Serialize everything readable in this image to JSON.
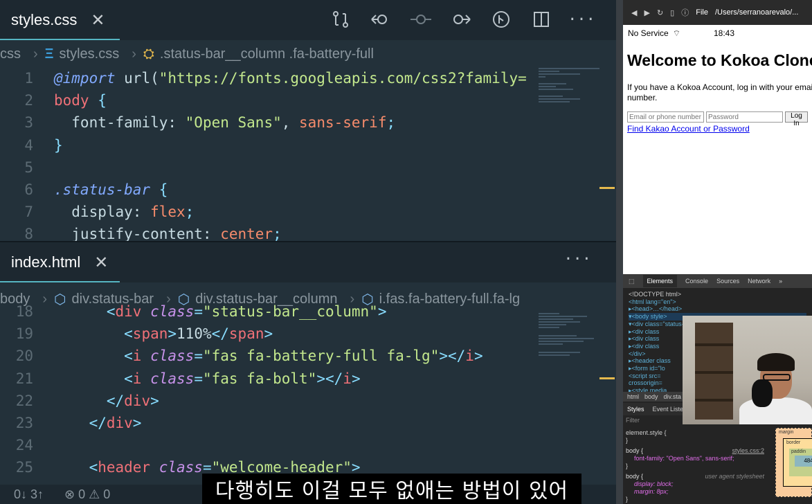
{
  "css_editor": {
    "tab_label": "styles.css",
    "breadcrumb": [
      "css",
      "styles.css",
      ".status-bar__column .fa-battery-full"
    ],
    "lines": [
      {
        "n": "1",
        "parts": [
          [
            "at",
            "@import"
          ],
          [
            "prop",
            " url("
          ],
          [
            "str",
            "\"https://fonts.googleapis.com/css2?family="
          ]
        ]
      },
      {
        "n": "2",
        "parts": [
          [
            "kw",
            "body"
          ],
          [
            "punct",
            " {"
          ]
        ]
      },
      {
        "n": "3",
        "parts": [
          [
            "prop",
            "  font-family: "
          ],
          [
            "str",
            "\"Open Sans\""
          ],
          [
            "prop",
            ", "
          ],
          [
            "val",
            "sans-serif"
          ],
          [
            "punct",
            ";"
          ]
        ]
      },
      {
        "n": "4",
        "parts": [
          [
            "punct",
            "}"
          ]
        ]
      },
      {
        "n": "5",
        "parts": []
      },
      {
        "n": "6",
        "parts": [
          [
            "sel",
            ".status-bar"
          ],
          [
            "punct",
            " {"
          ]
        ]
      },
      {
        "n": "7",
        "parts": [
          [
            "prop",
            "  display: "
          ],
          [
            "val",
            "flex"
          ],
          [
            "punct",
            ";"
          ]
        ]
      },
      {
        "n": "8",
        "parts": [
          [
            "prop",
            "  justify-content: "
          ],
          [
            "val",
            "center"
          ],
          [
            "punct",
            ";"
          ]
        ]
      }
    ]
  },
  "html_editor": {
    "tab_label": "index.html",
    "breadcrumb": [
      "body",
      "div.status-bar",
      "div.status-bar__column",
      "i.fas.fa-battery-full.fa-lg"
    ],
    "lines": [
      {
        "n": "18",
        "parts": [
          [
            "punct",
            "      <"
          ],
          [
            "tag",
            "div"
          ],
          [
            "attr",
            " class"
          ],
          [
            "punct",
            "="
          ],
          [
            "str",
            "\"status-bar__column\""
          ],
          [
            "punct",
            ">"
          ]
        ]
      },
      {
        "n": "19",
        "parts": [
          [
            "punct",
            "        <"
          ],
          [
            "tag",
            "span"
          ],
          [
            "punct",
            ">"
          ],
          [
            "prop",
            "110%"
          ],
          [
            "punct",
            "</"
          ],
          [
            "tag",
            "span"
          ],
          [
            "punct",
            ">"
          ]
        ]
      },
      {
        "n": "20",
        "parts": [
          [
            "punct",
            "        <"
          ],
          [
            "tag",
            "i"
          ],
          [
            "attr",
            " class"
          ],
          [
            "punct",
            "="
          ],
          [
            "str",
            "\"fas fa-battery-full fa-lg\""
          ],
          [
            "punct",
            "></"
          ],
          [
            "tag",
            "i"
          ],
          [
            "punct",
            ">"
          ]
        ]
      },
      {
        "n": "21",
        "parts": [
          [
            "punct",
            "        <"
          ],
          [
            "tag",
            "i"
          ],
          [
            "attr",
            " class"
          ],
          [
            "punct",
            "="
          ],
          [
            "str",
            "\"fas fa-bolt\""
          ],
          [
            "punct",
            "></"
          ],
          [
            "tag",
            "i"
          ],
          [
            "punct",
            ">"
          ]
        ]
      },
      {
        "n": "22",
        "parts": [
          [
            "punct",
            "      </"
          ],
          [
            "tag",
            "div"
          ],
          [
            "punct",
            ">"
          ]
        ]
      },
      {
        "n": "23",
        "parts": [
          [
            "punct",
            "    </"
          ],
          [
            "tag",
            "div"
          ],
          [
            "punct",
            ">"
          ]
        ]
      },
      {
        "n": "24",
        "parts": []
      },
      {
        "n": "25",
        "parts": [
          [
            "punct",
            "    <"
          ],
          [
            "tag",
            "header"
          ],
          [
            "attr",
            " class"
          ],
          [
            "punct",
            "="
          ],
          [
            "str",
            "\"welcome-header\""
          ],
          [
            "punct",
            ">"
          ]
        ]
      }
    ]
  },
  "statusbar": {
    "sync": "0↓ 3↑",
    "problems": "⊗ 0 ⚠ 0"
  },
  "browser": {
    "file_label": "File",
    "url": "/Users/serranoarevalo/...",
    "carrier": "No Service",
    "time": "18:43",
    "heading": "Welcome to Kokoa Clone",
    "intro_1": "If you have a Kokoa Account, log in with your email or phone",
    "intro_2": "number.",
    "email_placeholder": "Email or phone number",
    "password_placeholder": "Password",
    "login_button": "Log In",
    "link": "Find Kakao Account or Password"
  },
  "devtools": {
    "tabs": [
      "Elements",
      "Console",
      "Sources",
      "Network"
    ],
    "dom": [
      "<!DOCTYPE html>",
      "<html lang=\"en\">",
      "▸<head>…</head>",
      "▾<body style>",
      "  ▾<div class=\"status-bar\">",
      "    ▸<div class",
      "    ▸<div class",
      "    ▸<div class",
      "  </div>",
      "  ▸<header class",
      "  ▸<form id=\"lo",
      "   <script src=",
      "   crossorigin=",
      "  ▸<style media"
    ],
    "crumbs": [
      "html",
      "body",
      "div.sta"
    ],
    "style_tabs": [
      "Styles",
      "Event Listeners"
    ],
    "filter": "Filter",
    "rule_element": "element.style {",
    "rule_body": "body {",
    "rule_src": "styles.css:2",
    "rule_prop": "font-family: \"Open Sans\", sans-serif;",
    "rule_body2": "body {",
    "rule_src2": "user agent stylesheet",
    "rule_display": "display: block;",
    "rule_margin": "margin: 8px;",
    "box_content": "484",
    "box_margin": "margin",
    "box_border": "border",
    "box_padding": "paddin"
  },
  "subtitle": "다행히도 이걸 모두 없애는 방법이 있어"
}
